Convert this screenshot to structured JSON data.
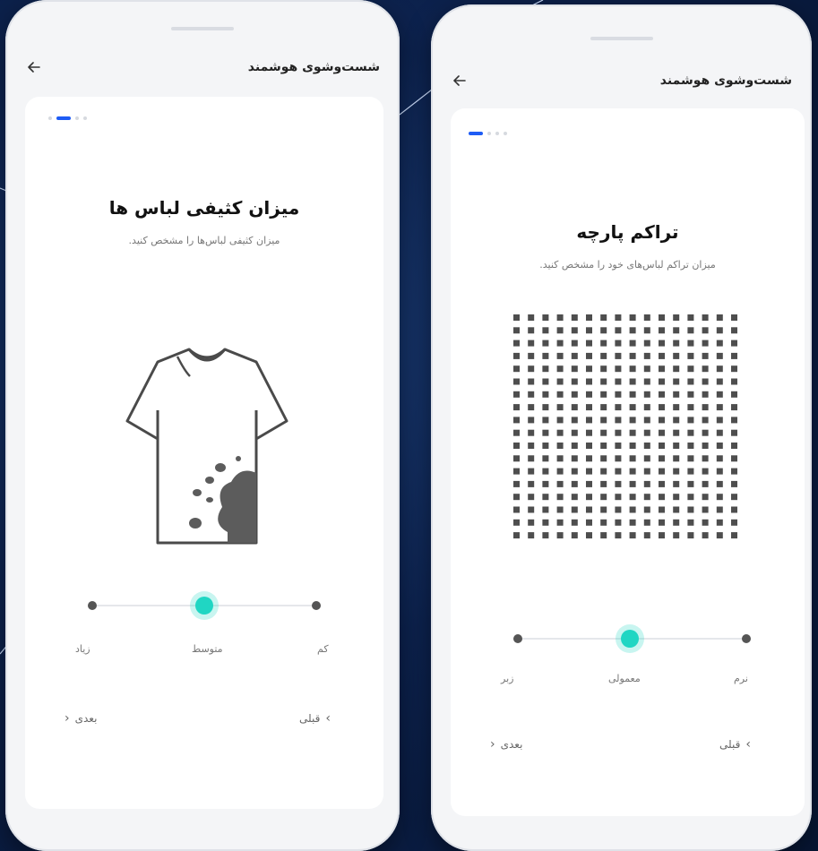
{
  "accent_color": "#1e5cf5",
  "slider_color": "#20d6c3",
  "screens": [
    {
      "title": "شست‌وشوی هوشمند",
      "step_dots": 4,
      "active_step": 2,
      "heading": "میزان کثیفی لباس ها",
      "subtitle": "میزان کثیفی لباس‌ها را مشخص کنید.",
      "illustration": "dirty-tshirt",
      "slider": {
        "options": [
          "کم",
          "متوسط",
          "زیاد"
        ],
        "selected": "متوسط"
      },
      "prev_label": "قبلی",
      "next_label": "بعدی"
    },
    {
      "title": "شست‌وشوی هوشمند",
      "step_dots": 4,
      "active_step": 1,
      "heading": "تراکم پارچه",
      "subtitle": "میزان تراکم لباس‌های خود را مشخص کنید.",
      "illustration": "fabric-density-grid",
      "slider": {
        "options": [
          "نرم",
          "معمولی",
          "زبر"
        ],
        "selected": "معمولی"
      },
      "prev_label": "قبلی",
      "next_label": "بعدی"
    }
  ]
}
